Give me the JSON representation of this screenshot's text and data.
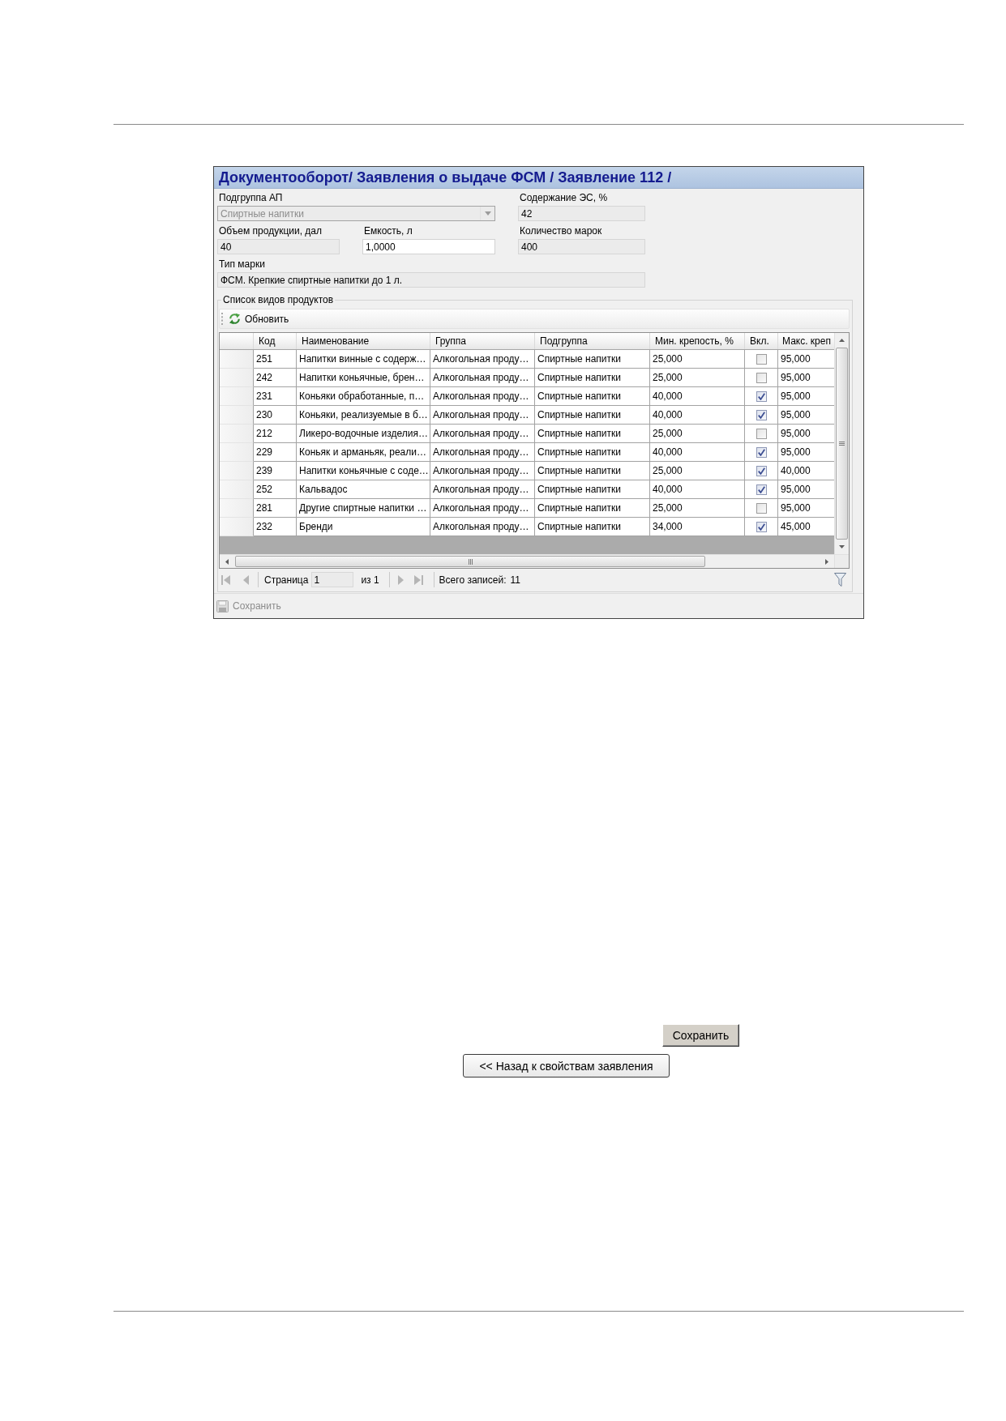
{
  "window": {
    "title": "Документооборот/ Заявления о выдаче ФСМ / Заявление 112 /"
  },
  "form": {
    "rows": [
      [
        {
          "label": "Подгруппа АП",
          "kind": "dropdown",
          "value": "Спиртные напитки",
          "editable": false,
          "disabled": true,
          "colspan": 2
        },
        {
          "label": "Содержание ЭС, %",
          "kind": "text",
          "value": "42",
          "editable": false,
          "disabled": false
        }
      ],
      [
        {
          "label": "Объем продукции, дал",
          "kind": "text",
          "value": "40",
          "editable": false,
          "disabled": false
        },
        {
          "label": "Емкость, л",
          "kind": "text",
          "value": "1,0000",
          "editable": true,
          "disabled": false
        },
        {
          "label": "Количество марок",
          "kind": "text",
          "value": "400",
          "editable": false,
          "disabled": false
        }
      ],
      [
        {
          "label": "Тип марки",
          "kind": "text",
          "value": "ФСМ. Крепкие спиртные напитки до 1 л.",
          "editable": false,
          "disabled": false,
          "colspan": 3
        }
      ]
    ]
  },
  "products": {
    "title": "Список видов продуктов",
    "toolbar": [
      {
        "label": "Обновить",
        "disabled": false
      }
    ],
    "table": {
      "columns": [
        {
          "label": "Код",
          "kind": "text"
        },
        {
          "label": "Наименование",
          "kind": "text"
        },
        {
          "label": "Группа",
          "kind": "text"
        },
        {
          "label": "Подгруппа",
          "kind": "text"
        },
        {
          "label": "Мин. крепость, %",
          "kind": "text"
        },
        {
          "label": "Вкл.",
          "kind": "check"
        },
        {
          "label": "Макс. креп",
          "kind": "text"
        }
      ],
      "rows": [
        {
          "cells": [
            "251",
            "Напитки винные с содерж…",
            "Алкогольная проду…",
            "Спиртные напитки",
            "25,000",
            "95,000"
          ],
          "checked": false
        },
        {
          "cells": [
            "242",
            "Напитки коньячные, брен…",
            "Алкогольная проду…",
            "Спиртные напитки",
            "25,000",
            "95,000"
          ],
          "checked": false
        },
        {
          "cells": [
            "231",
            "Коньяки обработанные, п…",
            "Алкогольная проду…",
            "Спиртные напитки",
            "40,000",
            "95,000"
          ],
          "checked": true
        },
        {
          "cells": [
            "230",
            "Коньяки, реализуемые в б…",
            "Алкогольная проду…",
            "Спиртные напитки",
            "40,000",
            "95,000"
          ],
          "checked": true
        },
        {
          "cells": [
            "212",
            "Ликеро-водочные изделия…",
            "Алкогольная проду…",
            "Спиртные напитки",
            "25,000",
            "95,000"
          ],
          "checked": false
        },
        {
          "cells": [
            "229",
            "Коньяк и арманьяк, реали…",
            "Алкогольная проду…",
            "Спиртные напитки",
            "40,000",
            "95,000"
          ],
          "checked": true
        },
        {
          "cells": [
            "239",
            "Напитки коньячные с соде…",
            "Алкогольная проду…",
            "Спиртные напитки",
            "25,000",
            "40,000"
          ],
          "checked": true
        },
        {
          "cells": [
            "252",
            "Кальвадос",
            "Алкогольная проду…",
            "Спиртные напитки",
            "40,000",
            "95,000"
          ],
          "checked": true
        },
        {
          "cells": [
            "281",
            "Другие спиртные напитки …",
            "Алкогольная проду…",
            "Спиртные напитки",
            "25,000",
            "95,000"
          ],
          "checked": false
        },
        {
          "cells": [
            "232",
            "Бренди",
            "Алкогольная проду…",
            "Спиртные напитки",
            "34,000",
            "45,000"
          ],
          "checked": true
        }
      ]
    },
    "pager": {
      "nav": [
        {
          "kind": "first",
          "disabled": true
        },
        {
          "kind": "prev",
          "disabled": true
        },
        {
          "kind": "next",
          "disabled": true
        },
        {
          "kind": "last",
          "disabled": true
        }
      ],
      "page_label": "Страница",
      "page": "1",
      "page_count": "из 1",
      "total_label": "Всего записей:",
      "total": "11"
    }
  },
  "footer_toolbar": [
    {
      "label": "Сохранить",
      "disabled": true
    }
  ],
  "buttons": [
    {
      "label": "Сохранить",
      "kind": "classic"
    },
    {
      "label": "<< Назад к свойствам заявления",
      "kind": "rounded"
    }
  ]
}
